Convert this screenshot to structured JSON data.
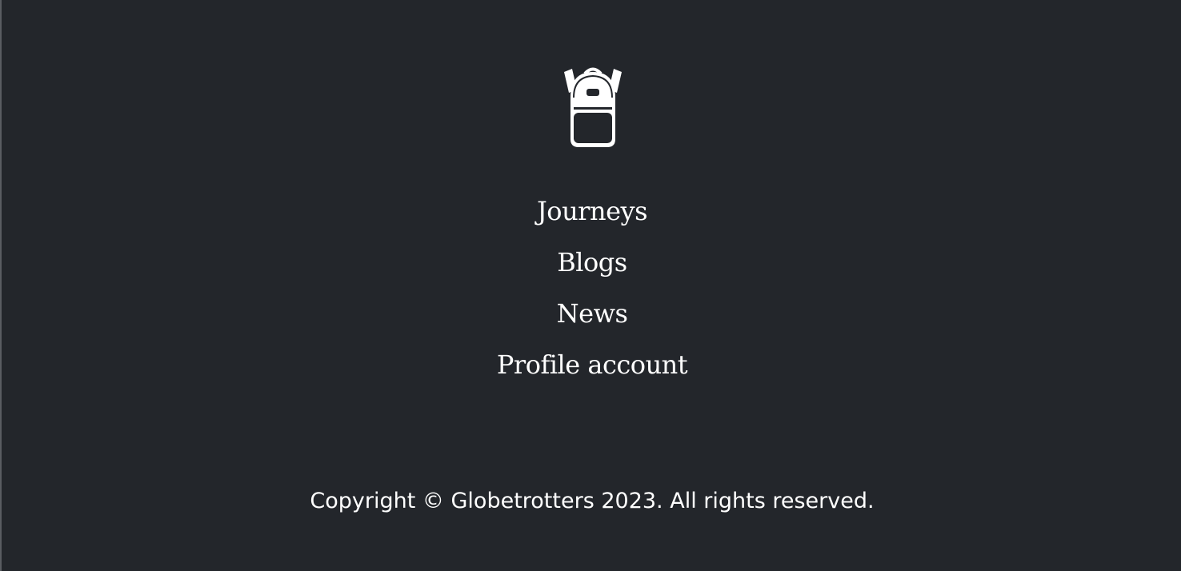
{
  "footer": {
    "logo_icon": "backpack-icon",
    "nav": [
      {
        "label": "Journeys"
      },
      {
        "label": "Blogs"
      },
      {
        "label": "News"
      },
      {
        "label": "Profile account"
      }
    ],
    "copyright": "Copyright © Globetrotters 2023. All rights reserved."
  },
  "colors": {
    "background": "#23262b",
    "text": "#ffffff"
  }
}
